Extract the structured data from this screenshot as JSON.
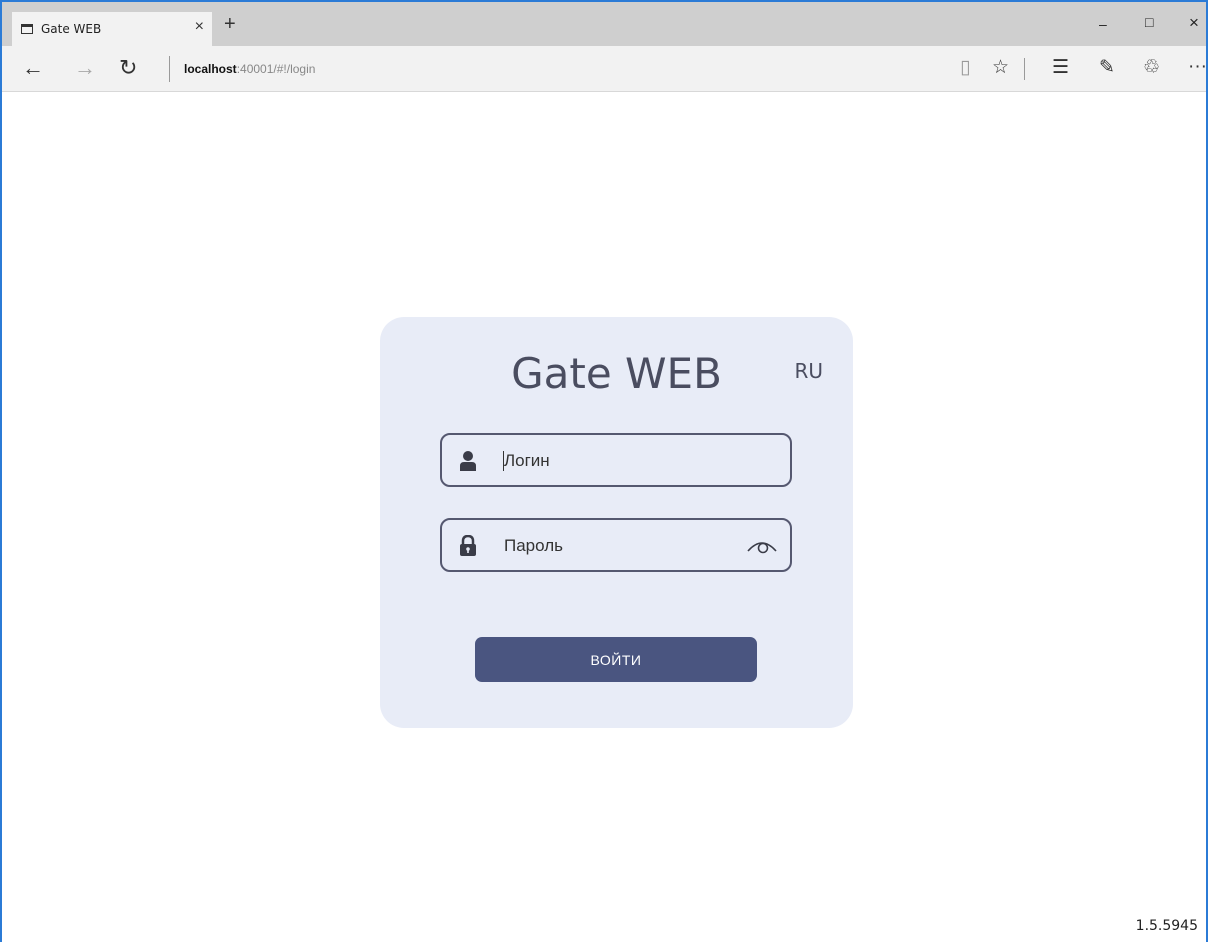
{
  "browser": {
    "tab_title": "Gate WEB",
    "tab_close": "×",
    "new_tab": "+",
    "controls": {
      "minimize": "–",
      "maximize": "□",
      "close": "×"
    },
    "nav": {
      "back": "←",
      "forward": "→",
      "refresh": "↻"
    },
    "url_host": "localhost",
    "url_rest": ":40001/#!/login",
    "tools": {
      "reading_view": "▯",
      "favorite": "☆",
      "hub": "☰",
      "notes": "✎",
      "share": "♲",
      "more": "···"
    }
  },
  "login": {
    "title": "Gate WEB",
    "language": "RU",
    "username_placeholder": "Логин",
    "password_placeholder": "Пароль",
    "submit_label": "ВОЙТИ"
  },
  "footer": {
    "version": "1.5.5945"
  },
  "colors": {
    "card_bg": "#e8ecf7",
    "accent": "#4a5580",
    "text": "#4a4d60",
    "window_border": "#2b7bd6"
  }
}
